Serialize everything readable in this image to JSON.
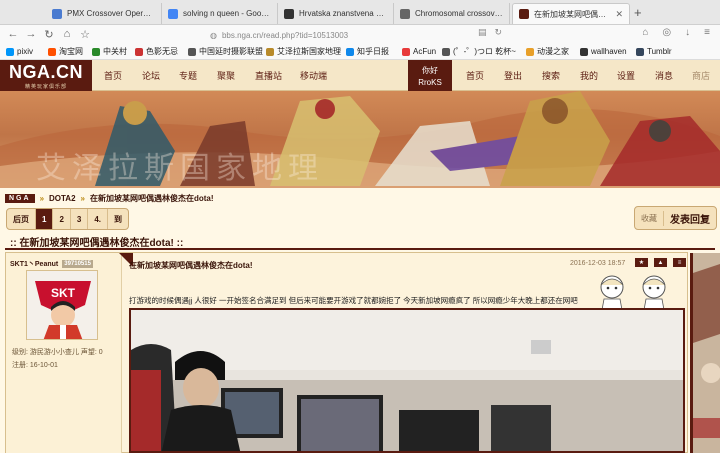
{
  "browser": {
    "tabs": [
      {
        "title": "PMX Crossover Operator Tu...",
        "favicon_color": "#4a7bd0"
      },
      {
        "title": "solving n queen - Google Sc...",
        "favicon_color": "#4285f4"
      },
      {
        "title": "Hrvatska znanstvena bibliog...",
        "favicon_color": "#333333"
      },
      {
        "title": "Chromosomal crossover -...",
        "favicon_color": "#666666"
      },
      {
        "title": "在新加坡某网吧偶遇林俊杰在dota!",
        "favicon_color": "#5a1b10"
      }
    ],
    "new_tab_symbol": "+",
    "url": "bbs.nga.cn/read.php?tid=10513003",
    "bookmarks": [
      {
        "label": "pixiv",
        "color": "#0096fa"
      },
      {
        "label": "淘宝网",
        "color": "#ff5000"
      },
      {
        "label": "中关村",
        "color": "#2a8a2a"
      },
      {
        "label": "色影无忌",
        "color": "#cc3333"
      },
      {
        "label": "中国延时摄影联盟",
        "color": "#555555"
      },
      {
        "label": "艾泽拉斯国家地理",
        "color": "#b88a2a"
      },
      {
        "label": "知乎日报",
        "color": "#0f88eb"
      },
      {
        "label": "AcFun",
        "color": "#e83a3a"
      },
      {
        "label": "(゜-゜)つロ 乾杯~",
        "color": "#555555"
      },
      {
        "label": "动漫之家",
        "color": "#e8a02a"
      },
      {
        "label": "wallhaven",
        "color": "#333333"
      },
      {
        "label": "Tumblr",
        "color": "#35465c"
      }
    ]
  },
  "site": {
    "logo": "NGA.CN",
    "logo_sub": "精英玩家俱乐部",
    "nav": [
      "首页",
      "论坛",
      "专题",
      "聚聚",
      "直播站",
      "移动端"
    ],
    "greeting": "你好",
    "username": "RroKS",
    "user_nav": [
      "首页",
      "登出",
      "搜索",
      "我的",
      "设置",
      "消息",
      "商店"
    ],
    "banner_watermark": "艾泽拉斯国家地理"
  },
  "forum": {
    "crumb_logo": "NGA",
    "crumbs": [
      "DOTA2",
      "在新加坡某网吧偶遇林俊杰在dota!"
    ],
    "pager": {
      "prev": "后页",
      "pages": [
        "1",
        "2",
        "3",
        "4."
      ],
      "go": "到",
      "current": "1"
    },
    "fav_label": "收藏",
    "reply_label": "发表回复",
    "thread_title": ":: 在新加坡某网吧偶遇林俊杰在dota! ::"
  },
  "post": {
    "author": "SKT1丶Peanut",
    "uid": "39710515",
    "level_label": "级别:",
    "level": "游民游小小查儿",
    "prestige_label": "声望:",
    "prestige": "0",
    "reg_label": "注册:",
    "reg_date": "16-10-01",
    "subject": "在新加坡某网吧偶遇林俊杰在dota!",
    "date": "2016-12-03 18:57",
    "body": "打游戏的时候偶遇jj 人很好 一开始签名合满足到 但后来可能要开游戏了就都婉拒了 今天新加坡网瘾疯了 所以网瘾少年大晚上都还在网吧",
    "icons": [
      "star-icon",
      "up-icon",
      "menu-icon"
    ]
  }
}
